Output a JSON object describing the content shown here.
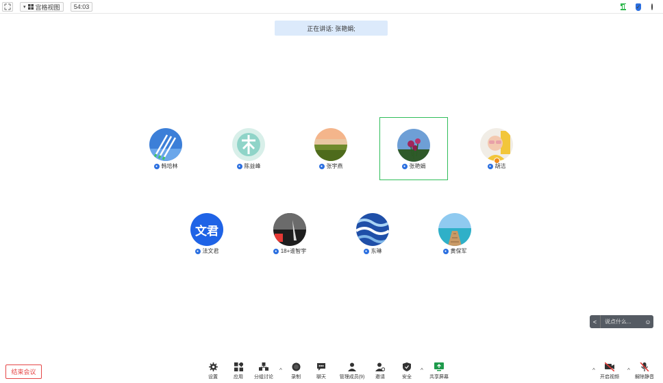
{
  "topbar": {
    "expand_icon": "expand-arrows-icon",
    "dropdown_arrow": "▾",
    "view_label": "宫格视图",
    "timer": "54:03",
    "right_icons": [
      "signal-bars-icon",
      "shield-icon",
      "info-icon"
    ]
  },
  "speaker_banner": "正在讲话: 张艳娟;",
  "participants": [
    {
      "name": "韩培林"
    },
    {
      "name": "陈益峰"
    },
    {
      "name": "张宇燕"
    },
    {
      "name": "张艳娟",
      "active": true
    },
    {
      "name": "胡洁",
      "host": true
    },
    {
      "name": "法文君",
      "avatar_text": "文君"
    },
    {
      "name": "18+谁智宇"
    },
    {
      "name": "东琳"
    },
    {
      "name": "黄保军"
    }
  ],
  "chat": {
    "placeholder": "说点什么...",
    "arrow": "<",
    "emoji": "☺"
  },
  "bottombar": {
    "end_meeting": "结束会议",
    "tools": [
      {
        "label": "设置"
      },
      {
        "label": "应用"
      },
      {
        "label": "分组讨论"
      },
      {
        "label": "录制"
      },
      {
        "label": "聊天"
      },
      {
        "label": "管理成员(9)"
      },
      {
        "label": "邀请"
      },
      {
        "label": "安全"
      },
      {
        "label": "共享屏幕"
      }
    ],
    "video_label": "开启视频",
    "mute_label": "解除静音",
    "caret": "^"
  },
  "colors": {
    "accent_blue": "#2b6fe0",
    "speaker_bg": "#dceafb",
    "active_border": "#2ebd59",
    "end_red": "#e54545",
    "share_green": "#1e9a4b"
  }
}
